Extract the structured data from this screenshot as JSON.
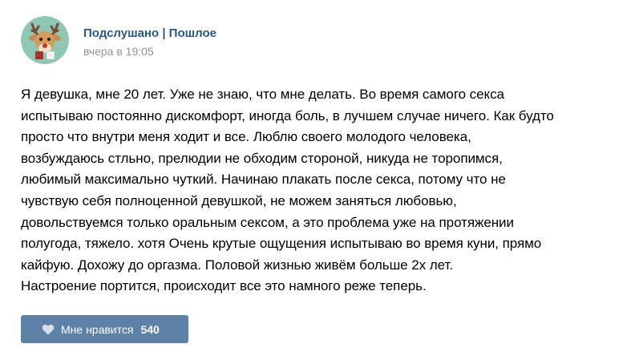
{
  "post": {
    "author": "Подслушано | Пошлое",
    "time": "вчера в 19:05",
    "avatar_icon": "deer-mascot-icon",
    "text": "Я девушка, мне 20 лет. Уже не знаю, что мне делать. Во время самого секса\nиспытываю постоянно дискомфорт, иногда боль, в лучшем случае ничего. Как будто\nпросто что внутри меня ходит и все. Люблю своего молодого человека,\nвозбуждаюсь стльно, прелюдии не обходим стороной, никуда не торопимся,\nлюбимый максимально чуткий. Начинаю плакать после секса, потому что не\nчувствую себя полноценной девушкой, не можем заняться любовью,\nдовольствуемся только оральным сексом, а это проблема уже на протяжении\nполугода, тяжело. хотя Очень крутые ощущения испытываю во время куни, прямо\nкайфую. Дохожу до оргазма. Половой жизнью живём больше 2х лет.\nНастроение портится, происходит все это намного реже теперь."
  },
  "like": {
    "label": "Мне нравится",
    "count": "540",
    "icon": "heart-icon"
  },
  "colors": {
    "author_link": "#2a5885",
    "time": "#939393",
    "like_button_bg": "#5e81a8",
    "avatar_bg": "#8fc7b6"
  }
}
